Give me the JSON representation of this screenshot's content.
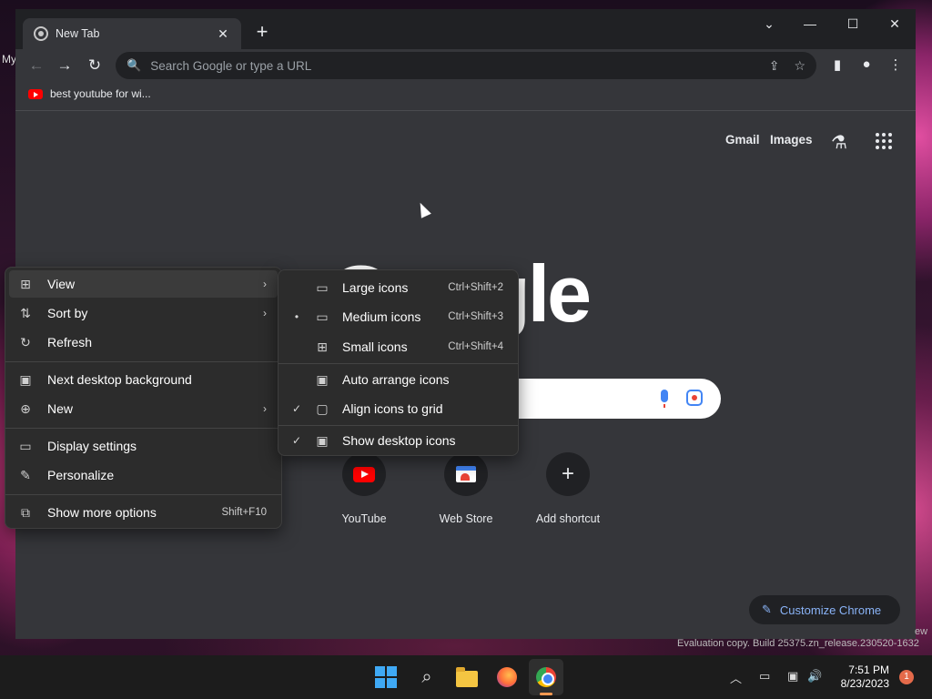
{
  "desktop": {
    "left_text": "My",
    "watermark": "Evaluation copy. Build 25375.zn_release.230520-1632",
    "watermark_right": "ew"
  },
  "browser": {
    "tab_title": "New Tab",
    "tab_close": "✕",
    "new_tab": "+",
    "win_controls": {
      "menu": "⌄",
      "minimize": "—",
      "maximize": "☐",
      "close": "✕"
    },
    "toolbar": {
      "back": "←",
      "forward": "→",
      "reload": "↻",
      "search_icon": "🔍",
      "omnibox_placeholder": "Search Google or type a URL",
      "share": "⇪",
      "star": "☆",
      "side_panel": "▮",
      "profile": "●",
      "more": "⋮"
    },
    "bookmark": {
      "label": "best youtube for wi..."
    },
    "ntp": {
      "gmail": "Gmail",
      "images": "Images",
      "labs_glyph": "⚗",
      "logo_text": "Google",
      "shortcuts": [
        {
          "label": "YouTube"
        },
        {
          "label": "Web Store"
        },
        {
          "label": "Add shortcut",
          "glyph": "+"
        }
      ],
      "customize": {
        "label": "Customize Chrome",
        "glyph": "✎"
      }
    }
  },
  "context_menu": {
    "items": [
      {
        "icon": "⊞",
        "label": "View",
        "arrow": "›"
      },
      {
        "icon": "⇅",
        "label": "Sort by",
        "arrow": "›"
      },
      {
        "icon": "↻",
        "label": "Refresh"
      },
      {
        "icon": "▣",
        "label": "Next desktop background"
      },
      {
        "icon": "⊕",
        "label": "New",
        "arrow": "›"
      },
      {
        "icon": "▭",
        "label": "Display settings"
      },
      {
        "icon": "✎",
        "label": "Personalize"
      },
      {
        "icon": "⧉",
        "label": "Show more options",
        "shortcut": "Shift+F10"
      }
    ]
  },
  "view_submenu": {
    "items": [
      {
        "check": "",
        "icon": "▭",
        "label": "Large icons",
        "shortcut": "Ctrl+Shift+2"
      },
      {
        "check": "•",
        "icon": "▭",
        "label": "Medium icons",
        "shortcut": "Ctrl+Shift+3"
      },
      {
        "check": "",
        "icon": "⊞",
        "label": "Small icons",
        "shortcut": "Ctrl+Shift+4"
      },
      {
        "check": "",
        "icon": "▣",
        "label": "Auto arrange icons",
        "shortcut": ""
      },
      {
        "check": "✓",
        "icon": "▢",
        "label": "Align icons to grid",
        "shortcut": ""
      },
      {
        "check": "✓",
        "icon": "▣",
        "label": "Show desktop icons",
        "shortcut": ""
      }
    ]
  },
  "taskbar": {
    "search_glyph": "⌕",
    "tray": {
      "chevron": "︿",
      "network": "▭",
      "device": "▣",
      "volume": "🔊"
    },
    "time": "7:51 PM",
    "date": "8/23/2023",
    "notification_count": "1"
  }
}
